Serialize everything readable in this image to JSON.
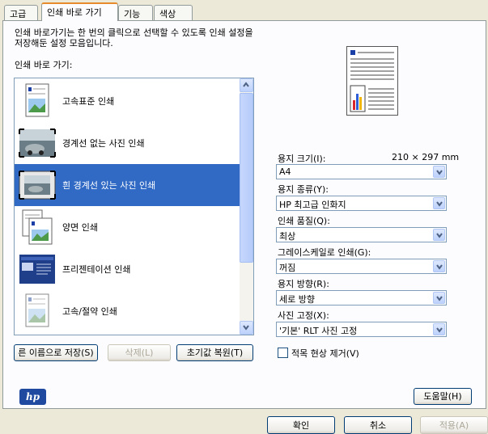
{
  "tabs": [
    "고급",
    "인쇄 바로 가기",
    "기능",
    "색상"
  ],
  "description": "인쇄 바로가기는 한 번의 클릭으로 선택할 수 있도록 인쇄 설정을 저장해둔 설정 모음입니다.",
  "shortcuts_label": "인쇄 바로 가기:",
  "shortcuts": [
    {
      "label": "고속표준 인쇄",
      "icon": "document-photo-icon",
      "selected": false
    },
    {
      "label": "경계선 없는 사진 인쇄",
      "icon": "borderless-photo-icon",
      "selected": false
    },
    {
      "label": "흰 경계선 있는 사진 인쇄",
      "icon": "bordered-photo-icon",
      "selected": true
    },
    {
      "label": "양면 인쇄",
      "icon": "two-sided-icon",
      "selected": false
    },
    {
      "label": "프리젠테이션 인쇄",
      "icon": "presentation-icon",
      "selected": false
    },
    {
      "label": "고속/절약 인쇄",
      "icon": "economy-document-icon",
      "selected": false
    }
  ],
  "buttons": {
    "save_as": "른 이름으로 저장(S)",
    "delete": "삭제(L)",
    "reset": "초기값 복원(T)",
    "help": "도움말(H)",
    "ok": "확인",
    "cancel": "취소",
    "apply": "적용(A)"
  },
  "fields": {
    "paper_size": {
      "label": "용지 크기(I):",
      "value": "A4",
      "dims": "210 × 297 mm"
    },
    "paper_type": {
      "label": "용지 종류(Y):",
      "value": "HP 최고급 인화지"
    },
    "quality": {
      "label": "인쇄 품질(Q):",
      "value": "최상"
    },
    "grayscale": {
      "label": "그레이스케일로 인쇄(G):",
      "value": "꺼짐"
    },
    "orientation": {
      "label": "용지 방향(R):",
      "value": "세로 방향"
    },
    "photo_fix": {
      "label": "사진 고정(X):",
      "value": "'기본' RLT 사진 고정"
    }
  },
  "red_eye": {
    "label": "적목 현상 제거(V)",
    "checked": false
  },
  "logo_text": "hp",
  "colors": {
    "selection": "#316ac5",
    "panel": "#fcfcfe",
    "dialog": "#ece9d8",
    "tab_highlight": "#e68b2c"
  }
}
